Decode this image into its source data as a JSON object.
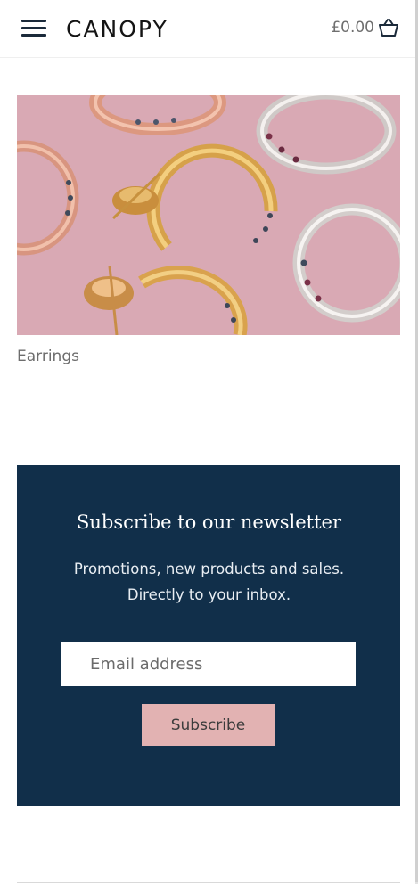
{
  "header": {
    "brand": "CANOPY",
    "cart_total": "£0.00",
    "menu_icon": "hamburger-menu-icon",
    "cart_icon": "basket-icon"
  },
  "product": {
    "category_label": "Earrings",
    "image_description": "gold and silver hoop earrings on pink background"
  },
  "newsletter": {
    "title": "Subscribe to our newsletter",
    "subtitle": "Promotions, new products and sales. Directly to your inbox.",
    "email_placeholder": "Email address",
    "button_label": "Subscribe"
  },
  "colors": {
    "newsletter_bg": "#112f4a",
    "button_bg": "#e2b2b2",
    "image_bg": "#d9a9b4"
  }
}
